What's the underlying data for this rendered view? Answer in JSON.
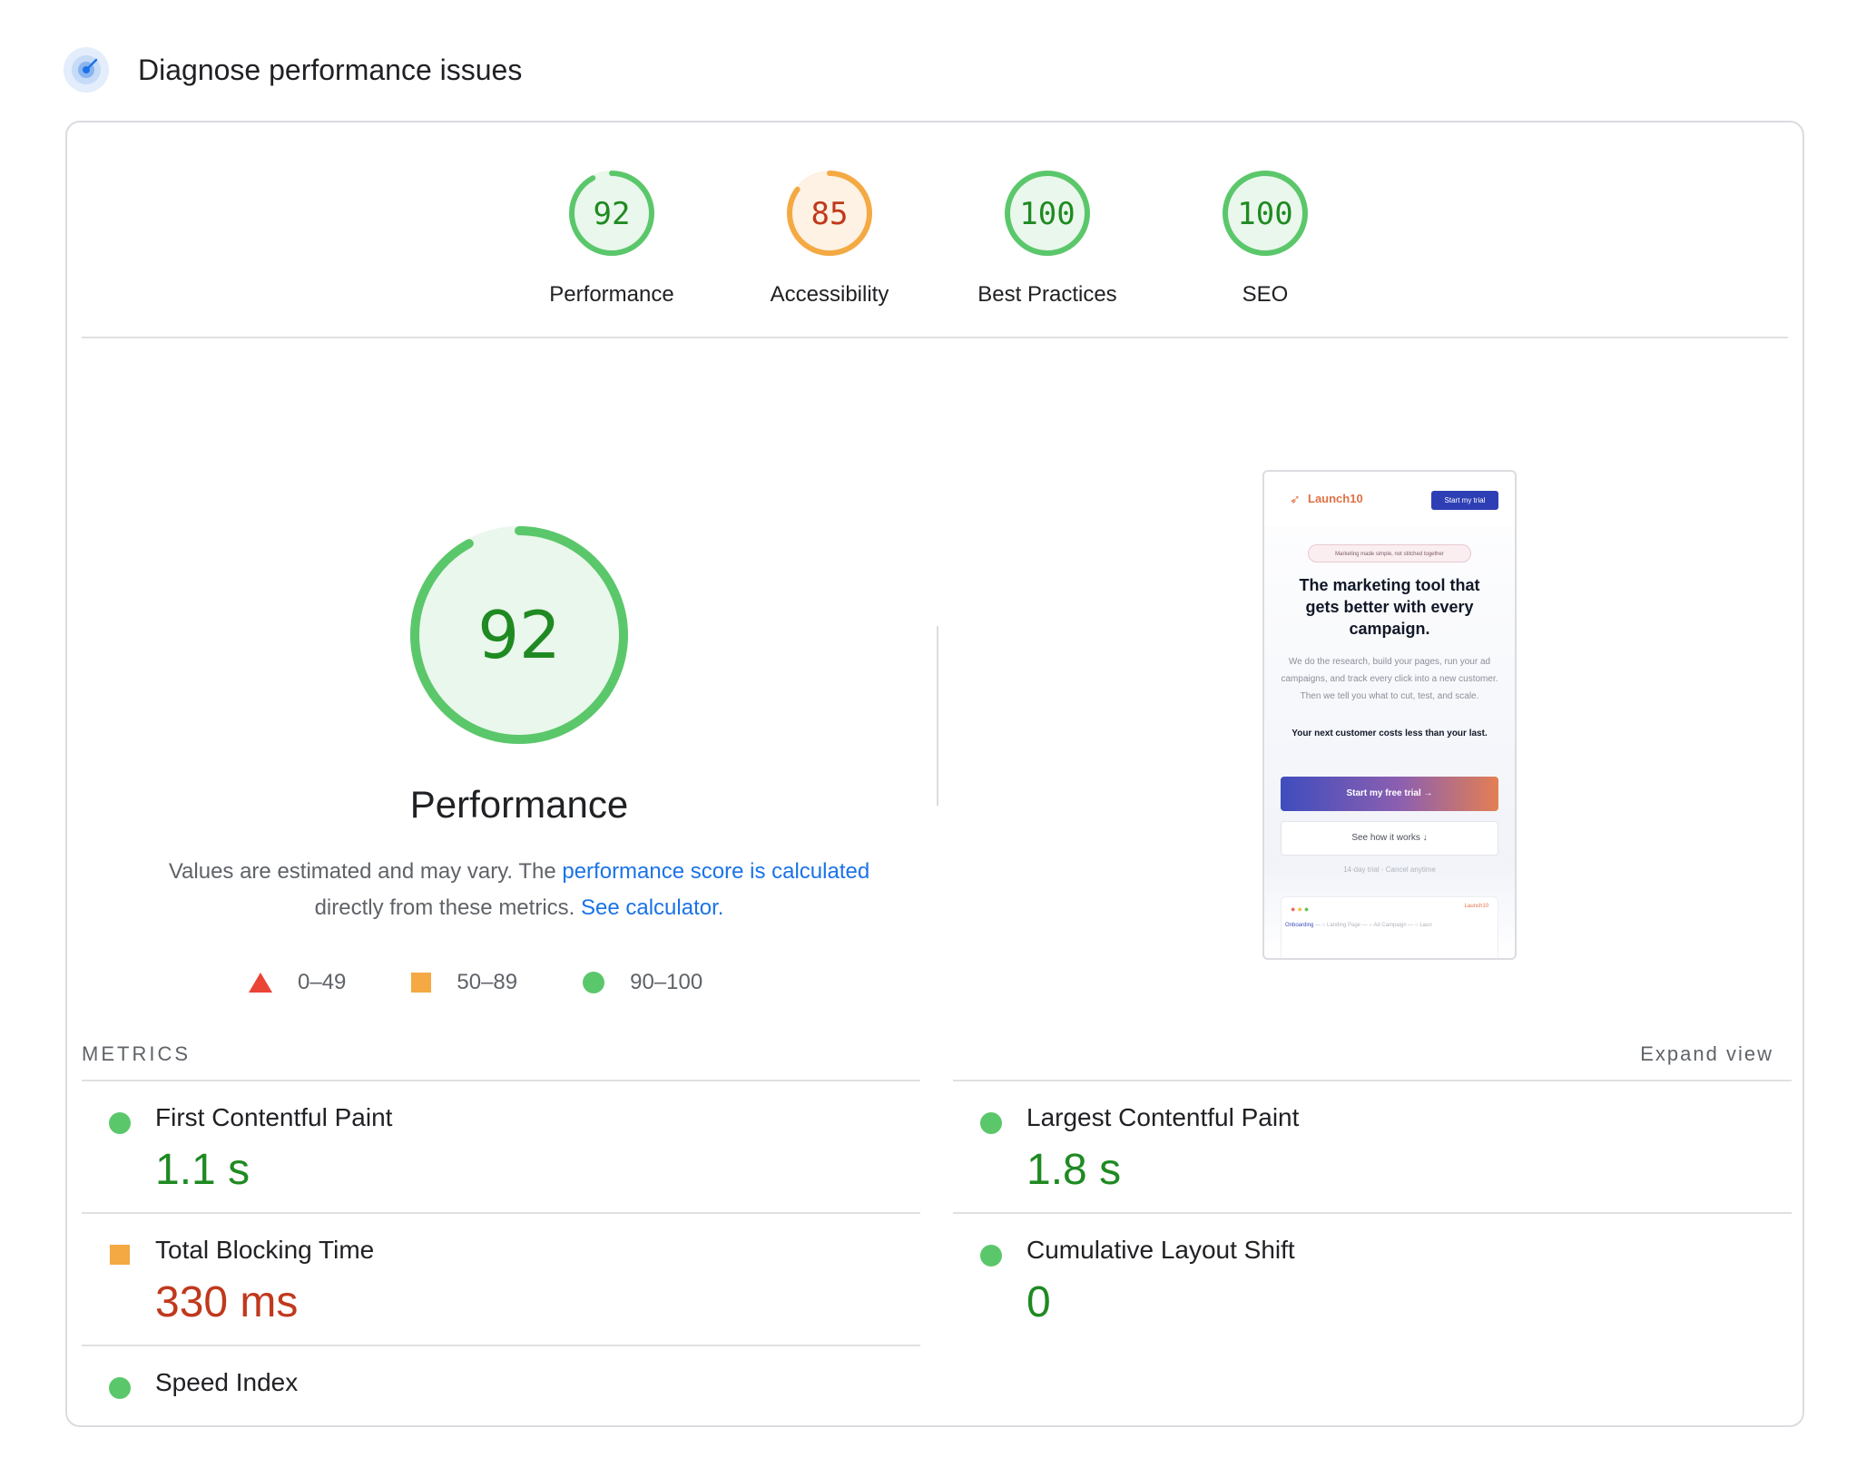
{
  "header": {
    "title": "Diagnose performance issues",
    "icon": "speedometer-icon"
  },
  "categories": [
    {
      "id": "performance",
      "label": "Performance",
      "score": 92,
      "fraction": 0.92,
      "rating": "pass"
    },
    {
      "id": "accessibility",
      "label": "Accessibility",
      "score": 85,
      "fraction": 0.85,
      "rating": "average"
    },
    {
      "id": "best_practices",
      "label": "Best Practices",
      "score": 100,
      "fraction": 1.0,
      "rating": "pass"
    },
    {
      "id": "seo",
      "label": "SEO",
      "score": 100,
      "fraction": 1.0,
      "rating": "pass"
    }
  ],
  "main": {
    "score": 92,
    "fraction": 0.92,
    "title": "Performance",
    "desc_pre": "Values are estimated and may vary. The ",
    "desc_link1": "performance score is calculated",
    "desc_mid": " directly from these metrics. ",
    "desc_link2": "See calculator."
  },
  "legend": [
    {
      "shape": "triangle",
      "range": "0–49"
    },
    {
      "shape": "square",
      "range": "50–89"
    },
    {
      "shape": "circle",
      "range": "90–100"
    }
  ],
  "screenshot": {
    "logo": "Launch10",
    "nav_button": "Start my trial",
    "badge": "Marketing made simple, not stitched together",
    "headline": "The marketing tool that gets better with every campaign.",
    "body": "We do the research, build your pages, run your ad campaigns, and track every click into a new customer. Then we tell you what to cut, test, and scale.",
    "tagline": "Your next customer costs less than your last.",
    "cta_primary": "Start my free trial →",
    "cta_secondary": "See how it works ↓",
    "trial_note": "14-day trial · Cancel anytime",
    "window_logo": "Launch10",
    "steps": [
      "Onboarding",
      "Landing Page",
      "Ad Campaign",
      "Laun"
    ]
  },
  "metrics": {
    "label": "METRICS",
    "expand": "Expand view",
    "items": [
      {
        "name": "First Contentful Paint",
        "value": "1.1 s",
        "rating": "pass"
      },
      {
        "name": "Largest Contentful Paint",
        "value": "1.8 s",
        "rating": "pass"
      },
      {
        "name": "Total Blocking Time",
        "value": "330 ms",
        "rating": "average"
      },
      {
        "name": "Cumulative Layout Shift",
        "value": "0",
        "rating": "pass"
      },
      {
        "name": "Speed Index",
        "value": "",
        "rating": "pass"
      }
    ]
  },
  "colors": {
    "pass": "#5bc76b",
    "pass_text": "#1f8a22",
    "pass_fill": "#eaf7ec",
    "average": "#f4a943",
    "average_text": "#c0391c",
    "average_fill": "#fdf2e3",
    "fail": "#eb4335",
    "link": "#1a73e8"
  }
}
